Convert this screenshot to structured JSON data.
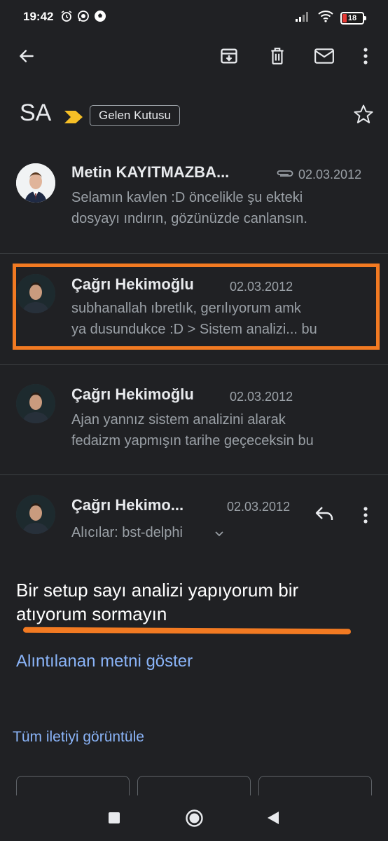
{
  "status_bar": {
    "time": "19:42",
    "battery": "18",
    "left_icons": [
      "alarm-icon",
      "whatsapp-icon",
      "soccer-ball-icon"
    ],
    "right_icons": [
      "signal-icon",
      "wifi-icon",
      "battery-icon"
    ]
  },
  "toolbar": {
    "back_icon": "back-arrow-icon",
    "actions": [
      "archive-icon",
      "delete-icon",
      "mark-unread-icon",
      "more-vert-icon"
    ]
  },
  "thread": {
    "subject": "SA",
    "label": "Gelen Kutusu"
  },
  "messages": [
    {
      "sender": "Metin KAYITMAZBA...",
      "date": "02.03.2012",
      "has_attachment": true,
      "snippet_line1": "Selamın kavlen :D öncelikle şu ekteki",
      "snippet_line2": "dosyayı ındırın, gözünüzde canlansın."
    },
    {
      "sender": "Çağrı Hekimoğlu",
      "date": "02.03.2012",
      "snippet_line1": "subhanallah ıbretlık, gerılıyorum amk",
      "snippet_line2": "ya dusundukce :D > Sistem analizi... bu"
    },
    {
      "sender": "Çağrı Hekimoğlu",
      "date": "02.03.2012",
      "snippet_line1": "Ajan yannız sistem analizini alarak",
      "snippet_line2": "fedaizm yapmışın tarihe geçeceksin bu"
    }
  ],
  "expanded": {
    "sender": "Çağrı Hekimo...",
    "date": "02.03.2012",
    "recipients": "Alıcılar: bst-delphi",
    "body_line1": "Bir setup sayı analizi yapıyorum bir",
    "body_line2": "atıyorum sormayın",
    "show_quoted": "Alıntılanan metni göster",
    "view_entire": "Tüm iletiyi görüntüle"
  },
  "colors": {
    "background": "#202124",
    "accent_link": "#8ab4f8",
    "highlight": "#f27a22",
    "importance": "#f6bf26"
  },
  "nav": [
    "recents-icon",
    "home-icon",
    "back-icon"
  ]
}
